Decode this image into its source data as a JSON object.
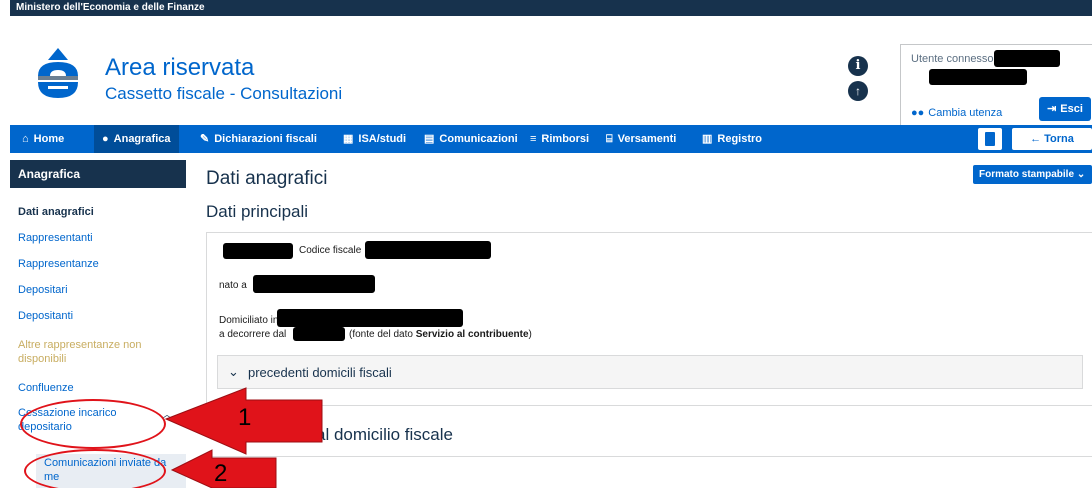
{
  "ministry": "Ministero dell'Economia e delle Finanze",
  "header": {
    "title": "Area riservata",
    "subtitle": "Cassetto fiscale - Consultazioni",
    "user_label": "Utente connesso:",
    "change_user": "Cambia utenza",
    "logout": "Esci"
  },
  "nav": {
    "items": [
      {
        "label": "Home",
        "icon": "home-icon"
      },
      {
        "label": "Anagrafica",
        "icon": "user-icon"
      },
      {
        "label": "Dichiarazioni fiscali",
        "icon": "edit-icon"
      },
      {
        "label": "ISA/studi",
        "icon": "calculator-icon"
      },
      {
        "label": "Comunicazioni",
        "icon": "document-icon"
      },
      {
        "label": "Rimborsi",
        "icon": "money-icon"
      },
      {
        "label": "Versamenti",
        "icon": "bank-icon"
      },
      {
        "label": "Registro",
        "icon": "book-icon"
      }
    ],
    "back": "← Torna"
  },
  "sidebar": {
    "header": "Anagrafica",
    "items": [
      "Dati anagrafici",
      "Rappresentanti",
      "Rappresentanze",
      "Depositari",
      "Depositanti",
      "Altre rappresentanze non disponibili",
      "Confluenze",
      "Cessazione incarico depositario",
      "Comunicazioni inviate da me"
    ]
  },
  "main": {
    "title": "Dati anagrafici",
    "format_button": "Formato stampabile",
    "section_title": "Dati principali",
    "codice_fiscale_label": "Codice fiscale",
    "nato_label": "nato a",
    "domicilio_label": "Domiciliato in",
    "decorrere_label": "a decorrere dal",
    "fonte_pre": "(fonte del dato",
    "fonte_bold": "Servizio al contribuente",
    "fonte_post": ")",
    "accordion": "precedenti domicili fiscali",
    "section2_title": "al domicilio fiscale"
  },
  "annotations": {
    "labels": [
      "1",
      "2"
    ],
    "color": "#e0131a"
  },
  "colors": {
    "primary": "#0066cc",
    "dark": "#17324d",
    "disabled": "#c8ad61"
  }
}
